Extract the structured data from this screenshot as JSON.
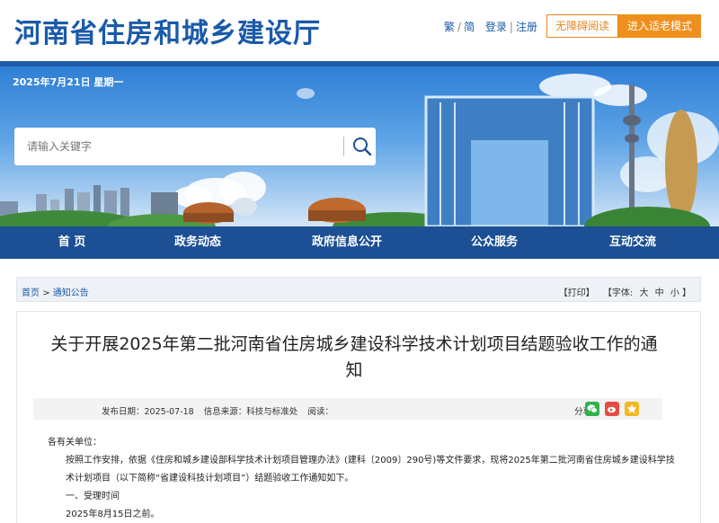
{
  "header": {
    "site_title": "河南省住房和城乡建设厅",
    "lang_trad": "繁",
    "lang_simp": "简",
    "login": "登录",
    "register": "注册",
    "accessibility": "无障碍阅读",
    "elder_mode": "进入适老模式"
  },
  "banner": {
    "date": "2025年7月21日 星期一",
    "search_placeholder": "请输入关键字"
  },
  "nav": {
    "items": [
      {
        "label": "首 页"
      },
      {
        "label": "政务动态"
      },
      {
        "label": "政府信息公开"
      },
      {
        "label": "公众服务"
      },
      {
        "label": "互动交流"
      }
    ]
  },
  "breadcrumb": {
    "home": "首页",
    "separator": ">",
    "current": "通知公告",
    "print": "【打印】",
    "font_label": "【字体:",
    "font_large": "大",
    "font_medium": "中",
    "font_small": "小",
    "font_close": "】"
  },
  "article": {
    "title": "关于开展2025年第二批河南省住房城乡建设科学技术计划项目结题验收工作的通知",
    "publish_label": "发布日期：",
    "publish_date": "2025-07-18",
    "source_label": "信息来源：",
    "source": "科技与标准处",
    "views_label": "阅读：",
    "share_label": "分享：",
    "share_icons": [
      "wechat-icon",
      "weibo-icon",
      "qzone-icon"
    ],
    "salutation": "各有关单位：",
    "para1": "按照工作安排，依据《住房和城乡建设部科学技术计划项目管理办法》(建科〔2009〕290号)等文件要求，现将2025年第二批河南省住房城乡建设科学技术计划项目（以下简称“省建设科技计划项目”）结题验收工作通知如下。",
    "section1": "一、受理时间",
    "section1_text": "2025年8月15日之前。"
  },
  "colors": {
    "brand_blue": "#1a5aa8",
    "nav_blue": "#1c4f93",
    "orange": "#ef8f1d"
  }
}
